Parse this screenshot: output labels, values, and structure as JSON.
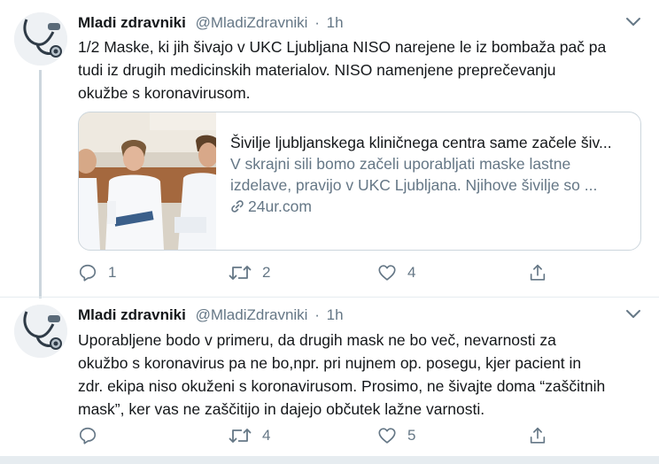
{
  "tweets": [
    {
      "name": "Mladi zdravniki",
      "handle": "@MladiZdravniki",
      "separator": "·",
      "time": "1h",
      "text": "1/2 Maske, ki jih šivajo v UKC Ljubljana NISO narejene le iz bombaža pač pa\ntudi iz drugih medicinskih materialov. NISO namenjene preprečevanju\nokužbe s koronavirusom.",
      "card": {
        "title": "Šivilje ljubljanskega kliničnega centra same začele šiv...",
        "description": "V skrajni sili bomo začeli uporabljati maske lastne izdelave, pravijo v UKC Ljubljana. Njihove šivilje so ...",
        "domain": "24ur.com"
      },
      "counts": {
        "reply": "1",
        "retweet": "2",
        "like": "4"
      }
    },
    {
      "name": "Mladi zdravniki",
      "handle": "@MladiZdravniki",
      "separator": "·",
      "time": "1h",
      "text": "Uporabljene bodo v primeru, da drugih mask ne bo več, nevarnosti za\nokužbo s koronavirus pa ne bo,npr. pri nujnem op. posegu, kjer pacient in\nzdr. ekipa niso okuženi s koronavirusom. Prosimo, ne šivajte doma “zaščitnih\nmask”, ker vas ne zaščitijo in dajejo občutek lažne varnosti.",
      "counts": {
        "reply": "",
        "retweet": "4",
        "like": "5"
      }
    }
  ],
  "icons": {
    "avatar": "stethoscope-icon",
    "menu": "chevron-down-icon",
    "reply": "reply-icon",
    "retweet": "retweet-icon",
    "like": "heart-icon",
    "share": "share-icon",
    "link": "link-icon"
  },
  "colors": {
    "text": "#14171a",
    "secondary": "#657786",
    "border": "#ccd6dd",
    "background": "#ffffff"
  }
}
